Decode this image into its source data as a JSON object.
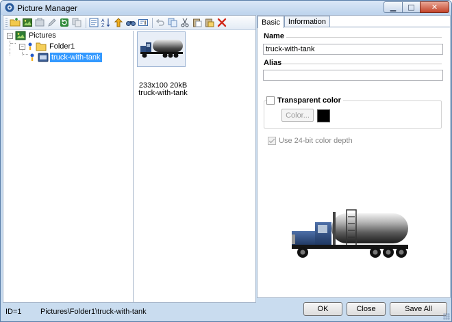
{
  "window": {
    "title": "Picture Manager",
    "close_glyph": "✕",
    "min_glyph": "▁",
    "max_glyph": "□"
  },
  "toolbar": {
    "buttons": [
      "new-folder-icon",
      "add-picture-icon",
      "import-icon",
      "edit-icon",
      "refresh-icon",
      "copy-icon",
      "properties-icon",
      "sort-icon",
      "move-up-icon",
      "find-icon",
      "rename-icon",
      "undo-icon",
      "copy2-icon",
      "cut-icon",
      "paste-icon",
      "paste-into-icon",
      "delete-icon"
    ]
  },
  "tree": {
    "root": {
      "label": "Pictures",
      "expander": "−"
    },
    "folder": {
      "label": "Folder1",
      "expander": "−"
    },
    "item": {
      "label": "truck-with-tank"
    }
  },
  "thumbnail": {
    "info": "233x100 20kB",
    "name": "truck-with-tank"
  },
  "tabs": [
    {
      "label": "Basic",
      "active": true
    },
    {
      "label": "Information",
      "active": false
    }
  ],
  "basic": {
    "name_label": "Name",
    "name_value": "truck-with-tank",
    "alias_label": "Alias",
    "alias_value": "",
    "transparent_label": "Transparent color",
    "transparent_checked": false,
    "color_button": "Color...",
    "swatch_color": "#000000",
    "depth_label": "Use 24-bit color depth",
    "depth_checked": true
  },
  "status": {
    "id": "ID=1",
    "path": "Pictures\\Folder1\\truck-with-tank"
  },
  "buttons": {
    "ok": "OK",
    "close": "Close",
    "save_all": "Save All"
  }
}
